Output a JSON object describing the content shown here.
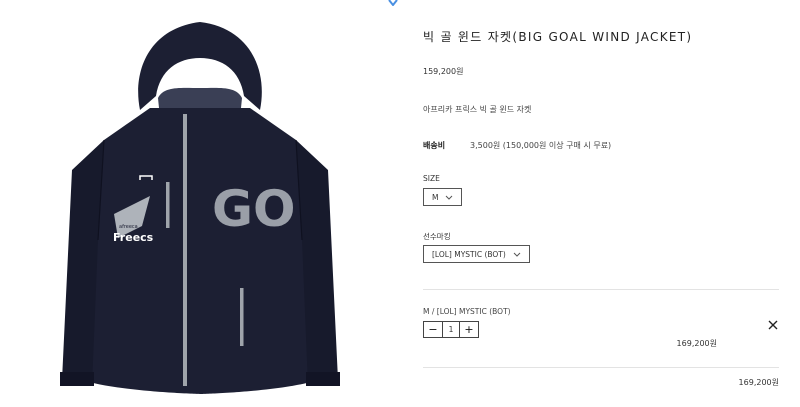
{
  "product": {
    "title": "빅 골 윈드 자켓(BIG GOAL WIND JACKET)",
    "price": "159,200원",
    "summary": "아프리카 프릭스 빅 골 윈드 자켓",
    "image_alt": "jacket",
    "image_print": "GO",
    "logo_text": "Freecs",
    "logo_subtext": "afreeca"
  },
  "shipping": {
    "label": "배송비",
    "value": "3,500원 (150,000원 이상 구매 시 무료)"
  },
  "options": {
    "size_label": "SIZE",
    "size_value": "M",
    "player_label": "선수마킹",
    "player_value": "[LOL] MYSTIC (BOT)"
  },
  "selected": {
    "name": "M / [LOL] MYSTIC (BOT)",
    "quantity": "1",
    "minus": "−",
    "plus": "+",
    "price": "169,200원",
    "remove_icon": "close-icon"
  },
  "total": {
    "price": "169,200원"
  },
  "colors": {
    "jacket": "#1c1f33",
    "zipper": "#9fa4ab",
    "text": "#333333"
  }
}
